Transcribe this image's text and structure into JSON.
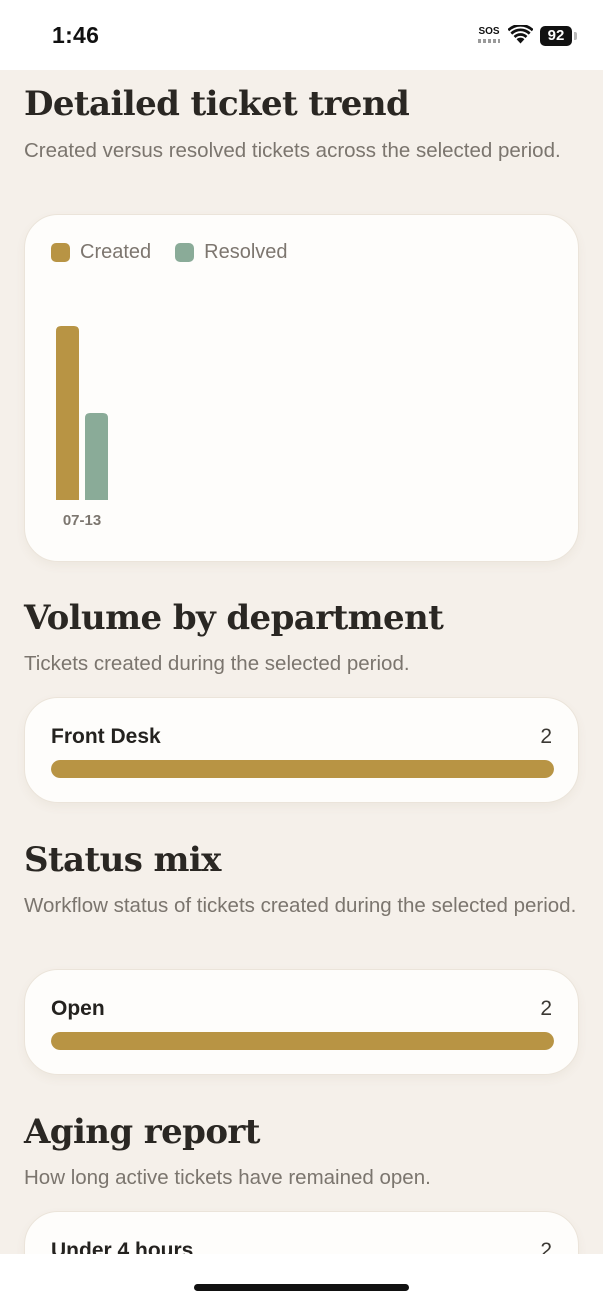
{
  "status_bar": {
    "time": "1:46",
    "sos": "SOS",
    "battery": "92"
  },
  "sections": {
    "trend": {
      "title": "Detailed ticket trend",
      "subtitle": "Created versus resolved tickets across the selected period."
    },
    "department": {
      "title": "Volume by department",
      "subtitle": "Tickets created during the selected period.",
      "row": {
        "label": "Front Desk",
        "value": "2",
        "fraction": 1.0
      }
    },
    "status": {
      "title": "Status mix",
      "subtitle": "Workflow status of tickets created during the selected period.",
      "row": {
        "label": "Open",
        "value": "2",
        "fraction": 1.0
      }
    },
    "aging": {
      "title": "Aging report",
      "subtitle": "How long active tickets have remained open.",
      "row": {
        "label": "Under 4 hours",
        "value": "2"
      }
    }
  },
  "chart_data": {
    "type": "bar",
    "categories": [
      "07-13"
    ],
    "series": [
      {
        "name": "Created",
        "values": [
          2
        ],
        "color": "#b89444"
      },
      {
        "name": "Resolved",
        "values": [
          1
        ],
        "color": "#8aab98"
      }
    ],
    "ylim": [
      0,
      2
    ],
    "grid": false,
    "legend": "top-left"
  },
  "colors": {
    "accent": "#b89444",
    "resolved": "#8aab98",
    "background": "#f5f0ea"
  }
}
